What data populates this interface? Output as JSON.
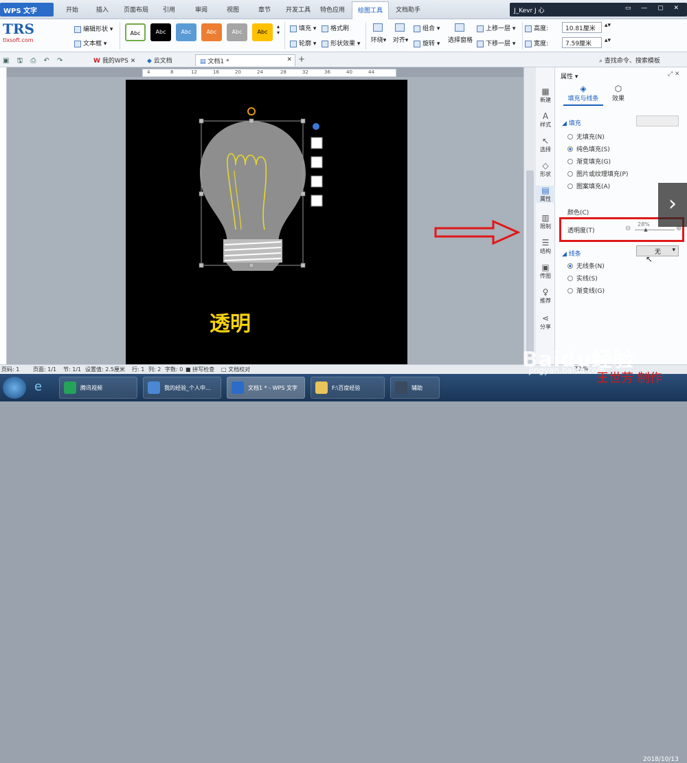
{
  "menubar": {
    "app_button": "WPS 文字",
    "tabs": [
      "开始",
      "插入",
      "页面布局",
      "引用",
      "审阅",
      "视图",
      "章节",
      "开发工具",
      "特色应用",
      "绘图工具",
      "文档助手"
    ],
    "active_tab": "绘图工具",
    "user": "J_Kevr J 心"
  },
  "ribbon": {
    "logo_text": "TRS",
    "logo_url": "tlxsoft.com",
    "edit_shape": "编辑形状",
    "text_box": "文本框",
    "style_label": "Abc",
    "fill": "填充",
    "format_brush": "格式刷",
    "outline": "轮廓",
    "shape_effect": "形状效果",
    "wrap": "环绕",
    "align": "对齐",
    "group": "组合",
    "rotate": "旋转",
    "selection_pane": "选择窗格",
    "bring_forward": "上移一层",
    "send_backward": "下移一层",
    "height_label": "高度:",
    "height_value": "10.81厘米",
    "width_label": "宽度:",
    "width_value": "7.59厘米",
    "style_colors": [
      "#ffffff",
      "#000000",
      "#5b9bd5",
      "#ed7d31",
      "#a5a5a5",
      "#ffc000"
    ]
  },
  "doctabs": {
    "tab1": "我的WPS",
    "tab2": "云文档",
    "tab3": "文档1 *",
    "search": "查找命令、搜索模板"
  },
  "ruler": {
    "ticks": [
      "4",
      "8",
      "12",
      "16",
      "20",
      "24",
      "28",
      "32",
      "36",
      "40",
      "44"
    ]
  },
  "document": {
    "caption": "透明",
    "caption_color": "#f5d210"
  },
  "sidenav": [
    "新建",
    "样式",
    "选择",
    "形状",
    "属性",
    "限制",
    "结构",
    "传图",
    "推荐",
    "分享"
  ],
  "panel": {
    "title": "属性",
    "tab_fill": "填充与线条",
    "tab_effect": "效果",
    "fill_section": "填充",
    "fill_options": [
      "无填充(N)",
      "纯色填充(S)",
      "渐变填充(G)",
      "图片或纹理填充(P)",
      "图案填充(A)"
    ],
    "fill_selected": 1,
    "color_label": "颜色(C)",
    "transparency_label": "透明度(T)",
    "transparency_value": "28%",
    "transparency_level": 0.28,
    "line_section": "线条",
    "line_value": "无",
    "line_options": [
      "无线条(N)",
      "实线(S)",
      "渐变线(G)"
    ],
    "line_selected": 0
  },
  "status": {
    "page": "页码: 1",
    "pages": "页面: 1/1",
    "section": "节: 1/1",
    "setting": "设置值: 2.5厘米",
    "row": "行: 1",
    "col": "列: 2",
    "words": "字数: 0",
    "spell": "拼写检查",
    "proof": "文档校对",
    "zoom": "70 %"
  },
  "taskbar": {
    "items": [
      "腾讯视频",
      "我的经验_个人中...",
      "文档1 * - WPS 文字",
      "F:\\百度经验",
      "辅助"
    ],
    "active": 2,
    "date": "2018/10/13"
  },
  "watermark": {
    "brand": "Baidu经验",
    "url": "jingyan.baidu.com",
    "signature": "王世芳 制作"
  }
}
